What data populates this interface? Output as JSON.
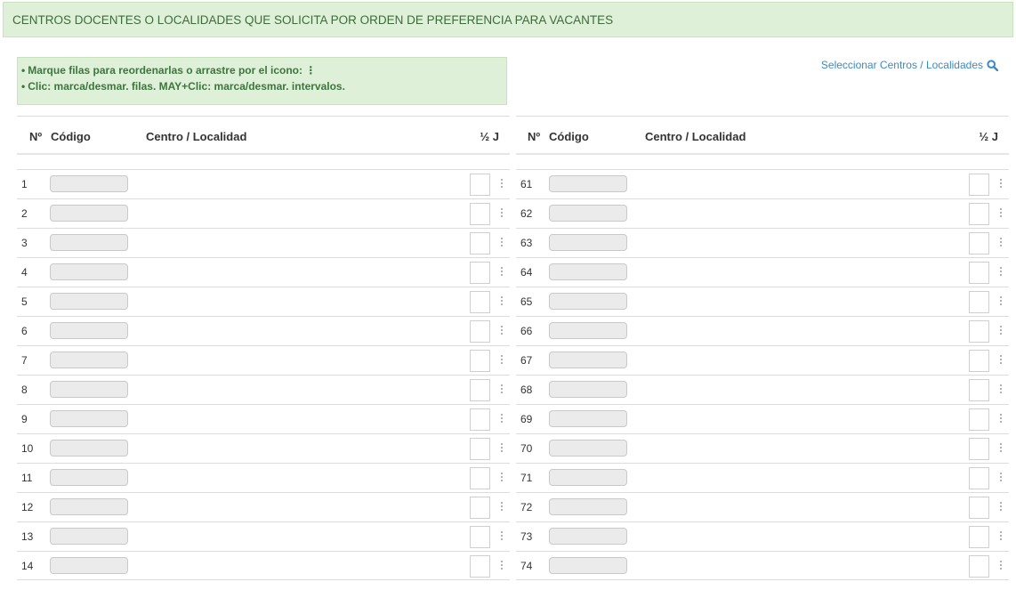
{
  "header": {
    "title": "CENTROS DOCENTES O LOCALIDADES QUE SOLICITA POR ORDEN DE PREFERENCIA PARA VACANTES"
  },
  "instructions": {
    "line1": "Marque filas para reordenarlas o arrastre por el icono: ⋮",
    "line2": "Clic: marca/desmar. filas. MAY+Clic: marca/desmar. intervalos.",
    "bullet": "•"
  },
  "select_link": {
    "label": "Seleccionar Centros / Localidades",
    "icon": "search-icon",
    "color": "#3b8ac4"
  },
  "columns": {
    "num": "Nº",
    "code": "Código",
    "center": "Centro / Localidad",
    "half": "½ J"
  },
  "left_rows": [
    "1",
    "2",
    "3",
    "4",
    "5",
    "6",
    "7",
    "8",
    "9",
    "10",
    "11",
    "12",
    "13",
    "14"
  ],
  "right_rows": [
    "61",
    "62",
    "63",
    "64",
    "65",
    "66",
    "67",
    "68",
    "69",
    "70",
    "71",
    "72",
    "73",
    "74"
  ],
  "colors": {
    "header_bg": "#dff0d8",
    "instructions_text": "#3c763d",
    "link": "#3b8ac4"
  }
}
